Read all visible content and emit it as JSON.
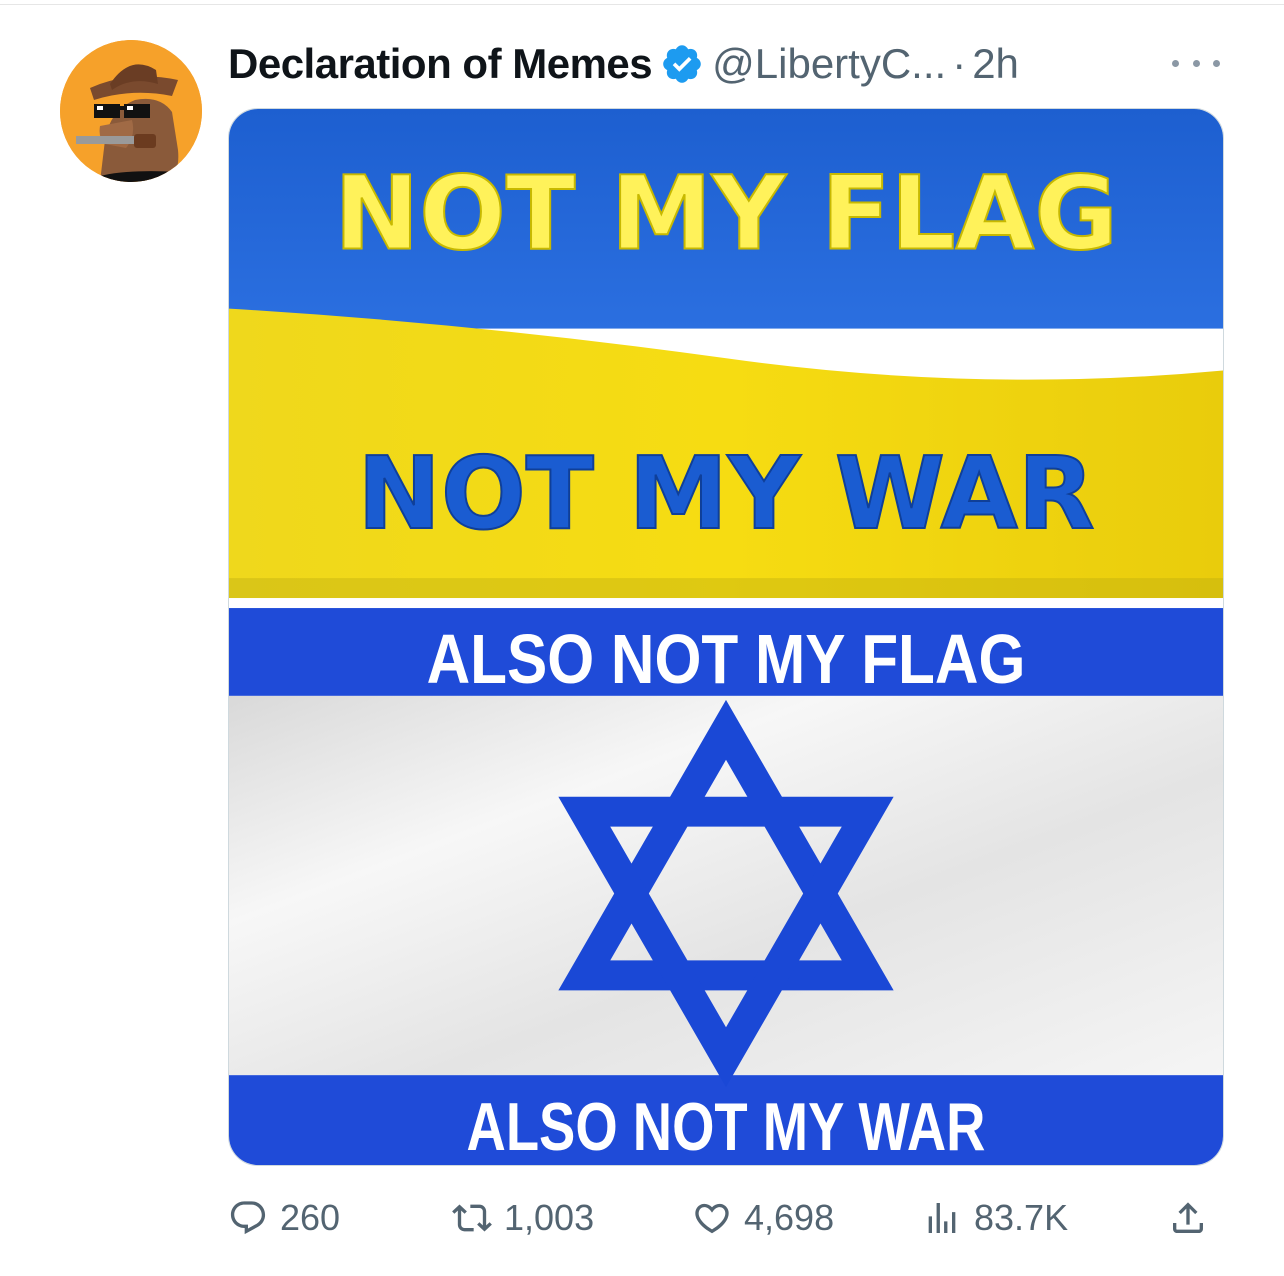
{
  "post": {
    "display_name": "Declaration of Memes",
    "handle": "@LibertyC...",
    "separator": "·",
    "time": "2h",
    "verified": true,
    "avatar_icon": "horse-cowboy-sunglasses-avatar",
    "more_icon": "more-horizontal-icon"
  },
  "meme": {
    "top_line_1": "NOT MY FLAG",
    "top_line_2": "NOT MY WAR",
    "bottom_line_1": "ALSO NOT MY FLAG",
    "bottom_line_2": "ALSO NOT MY WAR",
    "colors": {
      "ukraine_blue": "#1d5fd0",
      "ukraine_yellow": "#f2d514",
      "text_yellow": "#fff25a",
      "text_blue": "#1a5cd1",
      "israel_blue": "#1f4bd8",
      "israel_white": "#f4f4f4"
    }
  },
  "actions": {
    "replies": "260",
    "retweets": "1,003",
    "likes": "4,698",
    "views": "83.7K"
  },
  "colors": {
    "text_primary": "#0f1419",
    "text_secondary": "#536471",
    "verified_blue": "#1d9bf0"
  }
}
